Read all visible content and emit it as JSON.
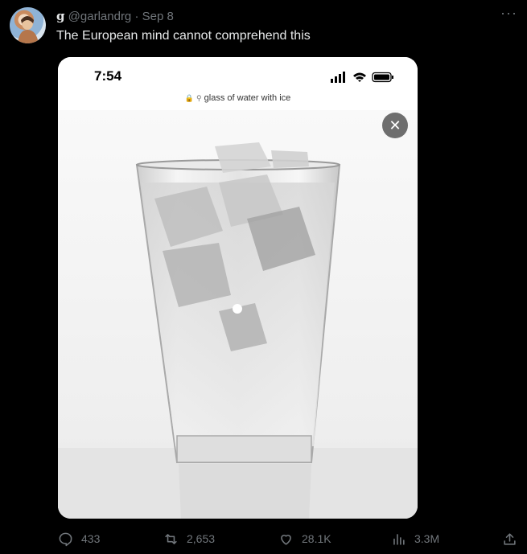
{
  "tweet": {
    "display_name": "g",
    "handle": "@garlandrg",
    "separator": "·",
    "date": "Sep 8",
    "text": "The European mind cannot comprehend this",
    "more_icon": "more-horizontal-icon"
  },
  "media": {
    "phone_time": "7:54",
    "url_text": "glass of water with ice",
    "close_icon": "close-icon",
    "photo_description_icon": "glass-of-water-image"
  },
  "actions": {
    "replies": "433",
    "retweets": "2,653",
    "likes": "28.1K",
    "views": "3.3M"
  },
  "colors": {
    "background": "#000000",
    "text_primary": "#e7e9ea",
    "text_secondary": "#71767b"
  }
}
